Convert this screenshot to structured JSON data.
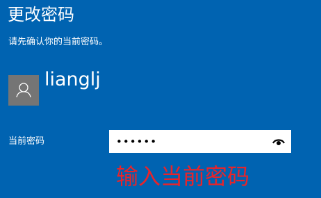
{
  "page": {
    "title": "更改密码",
    "subtitle": "请先确认你的当前密码。"
  },
  "account": {
    "username": "lianglj",
    "avatar_icon": "person-icon"
  },
  "password_field": {
    "label": "当前密码",
    "value": "••••••",
    "reveal_icon": "eye-icon"
  },
  "annotation": {
    "text": "输入当前密码",
    "color": "#e8242a"
  },
  "colors": {
    "background": "#0063b1",
    "avatar": "#757575",
    "text": "#ffffff"
  }
}
